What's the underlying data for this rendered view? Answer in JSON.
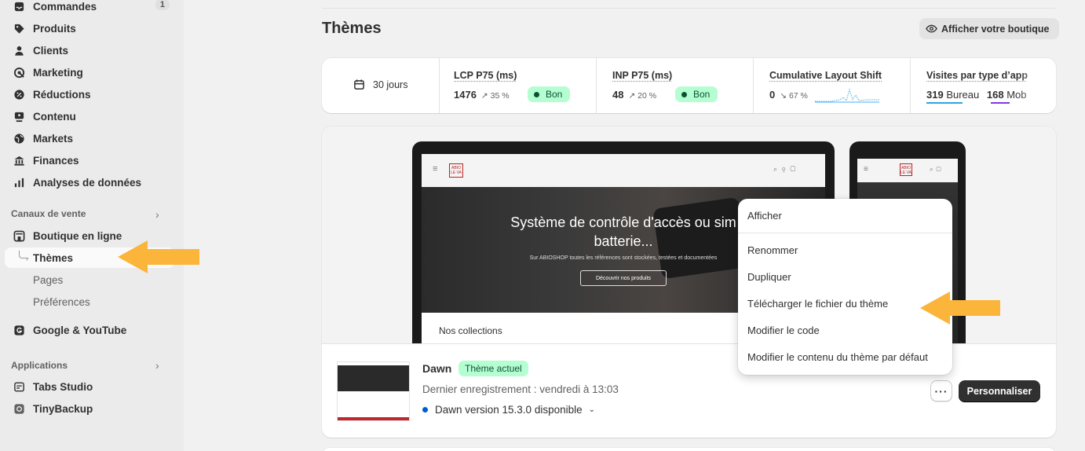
{
  "sidebar": {
    "orders": {
      "label": "Commandes",
      "count": "1"
    },
    "items": [
      {
        "label": "Produits",
        "icon": "tag-icon"
      },
      {
        "label": "Clients",
        "icon": "person-icon"
      },
      {
        "label": "Marketing",
        "icon": "target-icon"
      },
      {
        "label": "Réductions",
        "icon": "discount-icon"
      },
      {
        "label": "Contenu",
        "icon": "content-icon"
      },
      {
        "label": "Markets",
        "icon": "globe-icon"
      },
      {
        "label": "Finances",
        "icon": "bank-icon"
      },
      {
        "label": "Analyses de données",
        "icon": "bar-chart-icon"
      }
    ],
    "sales_channels_heading": "Canaux de vente",
    "online_store": "Boutique en ligne",
    "sub_items": [
      "Thèmes",
      "Pages",
      "Préférences"
    ],
    "google": "Google & YouTube",
    "apps_heading": "Applications",
    "apps": [
      "Tabs Studio",
      "TinyBackup"
    ]
  },
  "header": {
    "title": "Thèmes",
    "view_store": "Afficher votre boutique"
  },
  "metrics": {
    "period": "30 jours",
    "lcp": {
      "title": "LCP P75 (ms)",
      "value": "1476",
      "delta": "↗ 35 %",
      "status": "Bon"
    },
    "inp": {
      "title": "INP P75 (ms)",
      "value": "48",
      "delta": "↗ 20 %",
      "status": "Bon"
    },
    "cls": {
      "title": "Cumulative Layout Shift",
      "value": "0",
      "delta": "↘ 67 %"
    },
    "visits": {
      "title": "Visites par type d’app",
      "desktop_value": "319",
      "desktop_label": "Bureau",
      "mobile_value": "168",
      "mobile_label": "Mob"
    }
  },
  "preview": {
    "hero_title_line1": "Système de contrôle d'accès ou sim",
    "hero_title_line2": "batterie...",
    "hero_subtitle": "Sur ABIOSHOP toutes les références sont stockées, testées et documentées",
    "hero_button": "Découvrir nos produits",
    "collections": "Nos collections",
    "logo_text": "ABIO LE VA"
  },
  "theme": {
    "name": "Dawn",
    "badge": "Thème actuel",
    "saved": "Dernier enregistrement : vendredi à 13:03",
    "version": "Dawn version 15.3.0 disponible",
    "more": "···",
    "customize": "Personnaliser"
  },
  "menu": {
    "items": [
      "Afficher",
      "Renommer",
      "Dupliquer",
      "Télécharger le fichier du thème",
      "Modifier le code",
      "Modifier le contenu du thème par défaut"
    ]
  },
  "colors": {
    "accent_arrow": "#fbb53a",
    "good_badge_bg": "#b4fed2",
    "primary_button": "#303030",
    "info_dot": "#005bd3"
  }
}
